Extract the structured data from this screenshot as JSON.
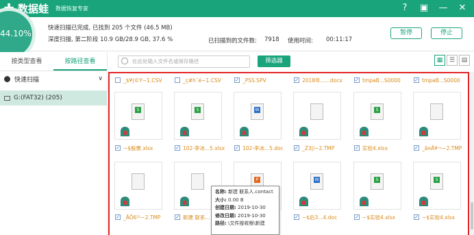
{
  "app": {
    "name": "数据蛙",
    "subtitle": "数据恢复专家"
  },
  "status": {
    "progress": "44.10%",
    "line1": "快速扫描已完成, 已找到 205 个文件 (46.5 MB)",
    "line2": "深度扫描, 第二阶段 10.9 GB/28.9 GB, 37.6 %",
    "scanned_label": "已扫描到的文件数:",
    "scanned_value": "7918",
    "time_label": "使用时间:",
    "time_value": "00:11:17",
    "pause_label": "暂停",
    "stop_label": "停止"
  },
  "sidebar": {
    "tabs": [
      {
        "label": "按类型查看"
      },
      {
        "label": "按路径查看"
      }
    ],
    "tree": [
      {
        "label": "快速扫描"
      },
      {
        "label": "G:(FAT32) (205)"
      }
    ]
  },
  "toolbar": {
    "search_placeholder": "在此处输入文件名或保存路径",
    "filter_label": "筛选器"
  },
  "files": [
    {
      "name": "_$¥|©Y~1.CSV",
      "checked": false,
      "type": "blank"
    },
    {
      "name": "_ç#h¯é~1.CSV",
      "checked": false,
      "type": "blank"
    },
    {
      "name": "_PSS.SPV",
      "checked": true,
      "type": "blank"
    },
    {
      "name": "2018年......docx",
      "checked": true,
      "type": "blank"
    },
    {
      "name": "tmpaB...S0000",
      "checked": true,
      "type": "blank"
    },
    {
      "name": "tmpaB...S0000",
      "checked": true,
      "type": "blank"
    },
    {
      "name": "~$股票.xlsx",
      "checked": true,
      "type": "xls"
    },
    {
      "name": "102-李冰...5.xlsx",
      "checked": true,
      "type": "xls"
    },
    {
      "name": "102-李冰...5.doc",
      "checked": true,
      "type": "doc"
    },
    {
      "name": "_Z3|i~2.TMP",
      "checked": true,
      "type": "blank"
    },
    {
      "name": "实验4.xlsx",
      "checked": true,
      "type": "xls"
    },
    {
      "name": "_ã¤Ä¥¬~2.TMP",
      "checked": true,
      "type": "blank"
    },
    {
      "name": "_ÄÕ6³¹~2.TMP",
      "checked": true,
      "type": "blank"
    },
    {
      "name": "新建 联系...",
      "checked": true,
      "type": "blank"
    },
    {
      "name": "",
      "checked": true,
      "type": "ppt"
    },
    {
      "name": "~$后3...4.doc",
      "checked": true,
      "type": "doc"
    },
    {
      "name": "~$实验4.xlsx",
      "checked": true,
      "type": "xls"
    },
    {
      "name": "~$实验4.xlsx",
      "checked": true,
      "type": "xls"
    }
  ],
  "tooltip": {
    "name_label": "名称:",
    "name_value": "新建 联系人.contact",
    "size_label": "大小:",
    "size_value": "0.00 B",
    "created_label": "创建日期:",
    "created_value": "2019-10-30",
    "modified_label": "修改日期:",
    "modified_value": "2019-10-30",
    "path_label": "路径:",
    "path_value": "\\文件按收根\\新建"
  },
  "colors": {
    "accent": "#1aa47b",
    "highlight": "#e32222",
    "file_name": "#d98a1a"
  }
}
